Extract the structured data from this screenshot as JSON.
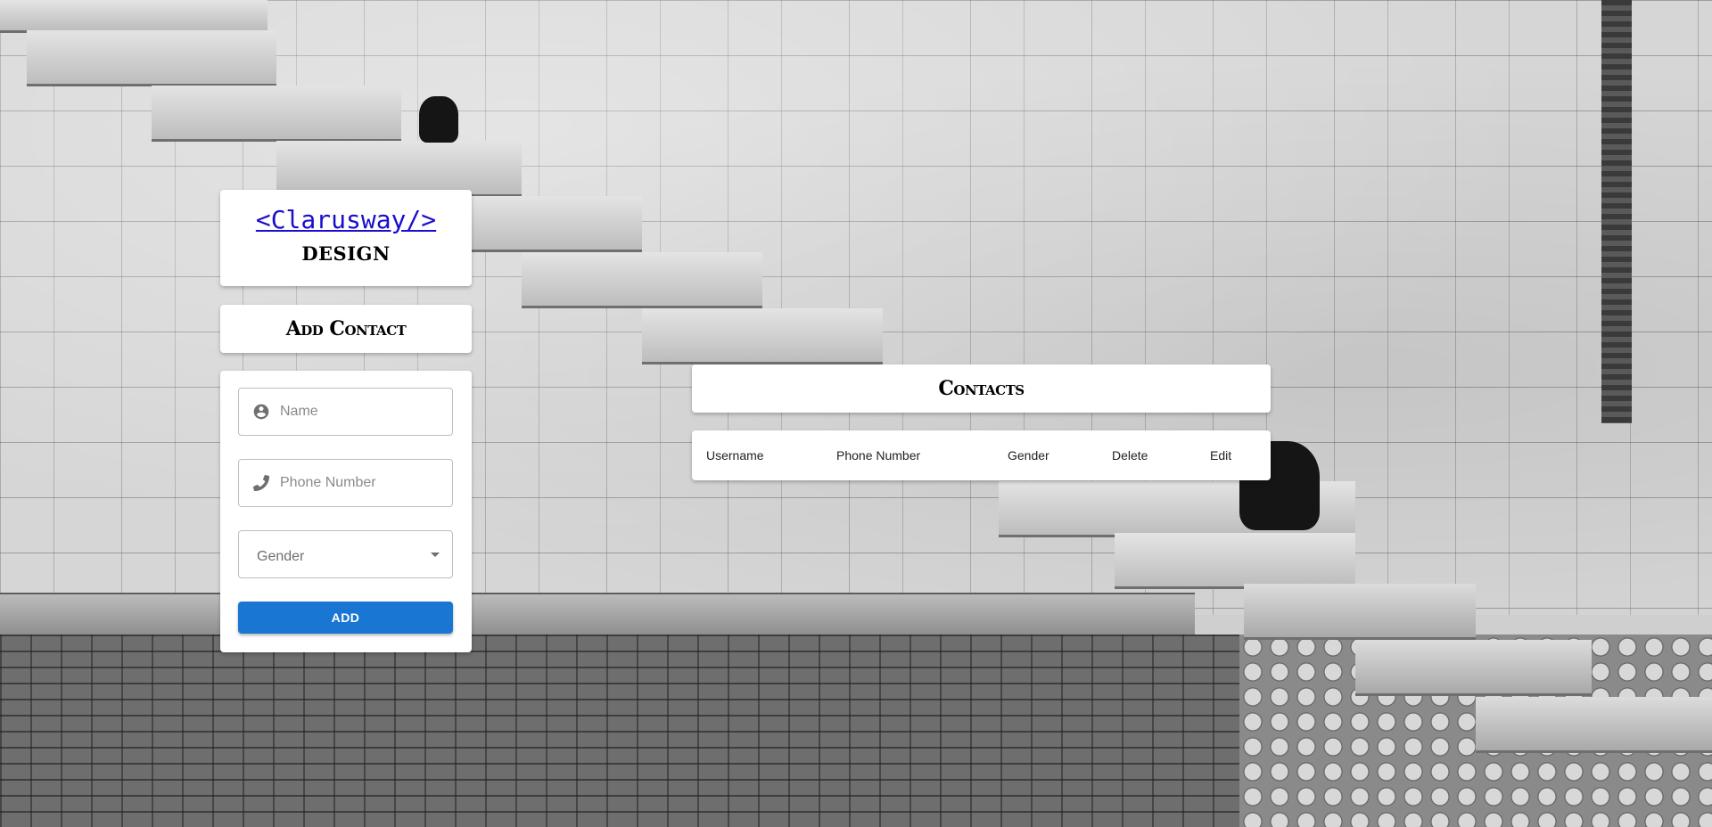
{
  "brand": {
    "logo_text": "<Clarusway/>",
    "subtitle": "DESIGN"
  },
  "add_contact": {
    "title": "Add Contact",
    "name_placeholder": "Name",
    "phone_placeholder": "Phone Number",
    "gender_label": "Gender",
    "add_button_label": "ADD"
  },
  "contacts": {
    "title": "Contacts",
    "columns": [
      "Username",
      "Phone Number",
      "Gender",
      "Delete",
      "Edit"
    ]
  },
  "colors": {
    "accent": "#1976d2",
    "link": "#1a0dcc"
  },
  "icons": {
    "name_field": "account-circle-icon",
    "phone_field": "phone-icon",
    "gender_field": "chevron-down-icon"
  }
}
